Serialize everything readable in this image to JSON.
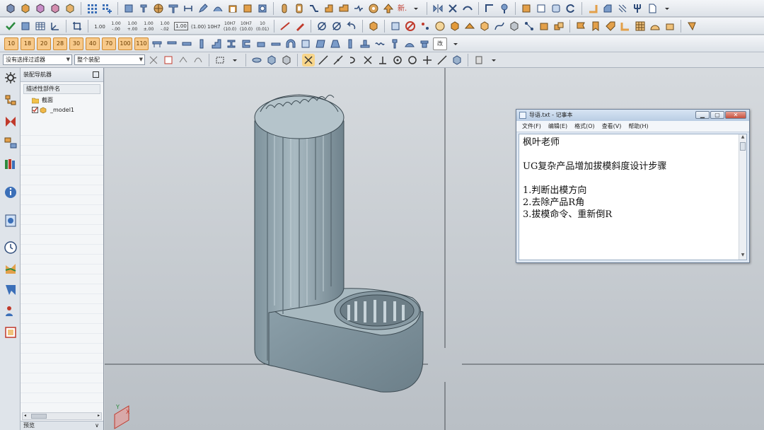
{
  "toolbar": {
    "row2_numbers": [
      "1.00",
      "1.00\n-.00",
      "1.00\n+.00",
      "1.00\n±.00",
      "1.00\n-.02",
      "1.00",
      "(1.00)",
      "10H7",
      "10H7\n(10.0)",
      "10H7\n(10.0)",
      "10\n(0.01)"
    ],
    "row3_buttons": [
      "10",
      "18",
      "20",
      "28",
      "30",
      "40",
      "70",
      "100",
      "110"
    ],
    "new_label": "新.",
    "change_label": "改"
  },
  "selection_bar": {
    "filter_value": "没有选择过滤器",
    "scope_value": "整个装配"
  },
  "navigator": {
    "title": "装配导航器",
    "column_header": "描述性部件名",
    "items": [
      {
        "label": "截面"
      },
      {
        "label": "_model1"
      }
    ],
    "footer_label": "预览"
  },
  "notepad": {
    "title": "导语.txt - 记事本",
    "menu": [
      "文件(F)",
      "编辑(E)",
      "格式(O)",
      "查看(V)",
      "帮助(H)"
    ],
    "lines": [
      "枫叶老师",
      "",
      "UG复杂产品增加拔模斜度设计步骤",
      "",
      "1.判断出模方向",
      "2.去除产品R角",
      "3.拔模命令、重新倒R"
    ]
  },
  "triad": {
    "x": "X",
    "y": "Y"
  },
  "colors": {
    "model_surface": "#8fa3ad",
    "viewport_top": "#d6dade",
    "viewport_bottom": "#b9bfc5",
    "accent_orange": "#e39a3a"
  }
}
